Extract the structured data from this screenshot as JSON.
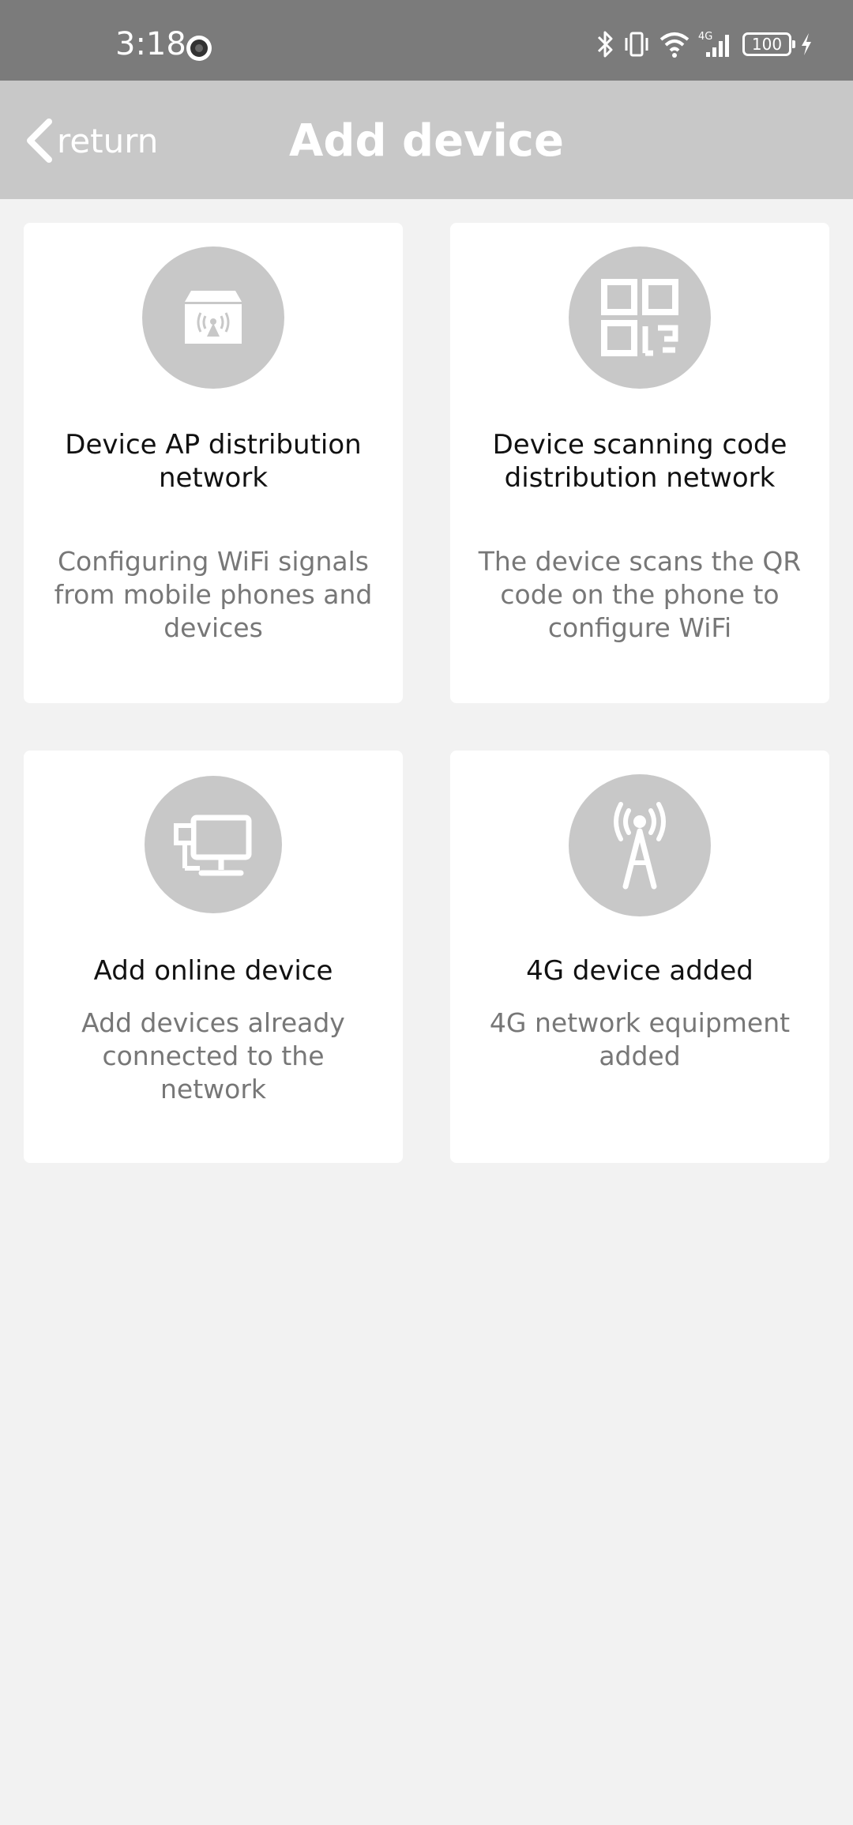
{
  "status_bar": {
    "time": "3:18",
    "battery": "100",
    "network_type": "4G",
    "icons": [
      "camera-icon",
      "bluetooth-icon",
      "vibrate-icon",
      "wifi-icon",
      "signal-icon",
      "battery-icon",
      "charging-icon"
    ]
  },
  "header": {
    "back_label": "return",
    "title": "Add device",
    "icons": [
      "chevron-left-icon"
    ]
  },
  "options": [
    {
      "title": "Device AP distribution network",
      "description": "Configuring WiFi signals from mobile phones and devices",
      "icon": "ap-router-icon"
    },
    {
      "title": "Device scanning code distribution network",
      "description": "The device scans the QR code on the phone to configure WiFi",
      "icon": "qr-code-icon"
    },
    {
      "title": "Add online device",
      "description": "Add devices already connected to the network",
      "icon": "network-monitor-icon"
    },
    {
      "title": "4G device added",
      "description": "4G network equipment added",
      "icon": "cell-tower-icon"
    }
  ],
  "colors": {
    "status_bar": "#7b7b7b",
    "header": "#c8c8c8",
    "background": "#f2f2f2",
    "card": "#ffffff",
    "icon_circle": "#c8c8c8",
    "title_text": "#111111",
    "description_text": "#777777"
  }
}
